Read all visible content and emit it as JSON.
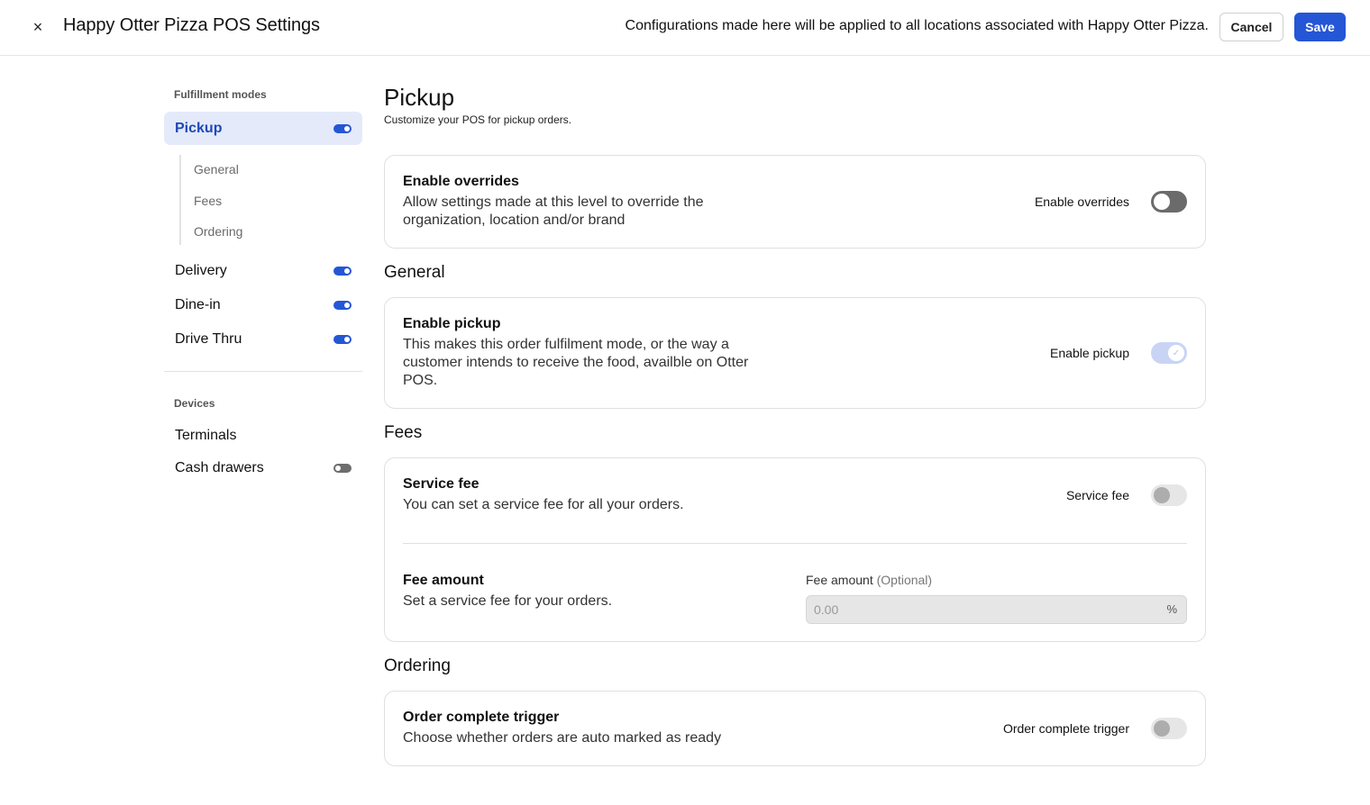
{
  "header": {
    "title": "Happy Otter Pizza POS Settings",
    "close_icon": "×",
    "notice": "Configurations made here will be applied to all locations associated with Happy Otter Pizza.",
    "cancel_label": "Cancel",
    "save_label": "Save"
  },
  "sidebar": {
    "fulfillment_heading": "Fulfillment modes",
    "pickup": {
      "label": "Pickup",
      "enabled": true
    },
    "pickup_subitems": [
      "General",
      "Fees",
      "Ordering"
    ],
    "delivery": {
      "label": "Delivery",
      "enabled": true
    },
    "dine_in": {
      "label": "Dine-in",
      "enabled": true
    },
    "drive_thru": {
      "label": "Drive Thru",
      "enabled": true
    },
    "devices_heading": "Devices",
    "terminals": {
      "label": "Terminals"
    },
    "cash_drawers": {
      "label": "Cash drawers",
      "enabled": false
    }
  },
  "main": {
    "title": "Pickup",
    "subtitle": "Customize your POS for pickup orders.",
    "overrides": {
      "title": "Enable overrides",
      "desc": "Allow settings made at this level to override the organization, location and/or brand",
      "toggle_label": "Enable overrides",
      "enabled": false
    },
    "general": {
      "heading": "General",
      "enable_pickup": {
        "title": "Enable pickup",
        "desc": "This makes this order fulfilment mode, or the way a customer intends to receive the food, availble on Otter POS.",
        "toggle_label": "Enable pickup",
        "enabled": true,
        "check_icon": "✓"
      }
    },
    "fees": {
      "heading": "Fees",
      "service_fee": {
        "title": "Service fee",
        "desc": "You can set a service fee for all your orders.",
        "toggle_label": "Service fee",
        "enabled": false
      },
      "fee_amount": {
        "title": "Fee amount",
        "desc": "Set a service fee for your orders.",
        "field_label": "Fee amount",
        "field_optional": "(Optional)",
        "placeholder": "0.00",
        "suffix": "%"
      }
    },
    "ordering": {
      "heading": "Ordering",
      "order_complete": {
        "title": "Order complete trigger",
        "desc": "Choose whether orders are auto marked as ready",
        "toggle_label": "Order complete trigger",
        "enabled": false
      }
    }
  },
  "colors": {
    "accent": "#2456d6",
    "active_bg": "#e4eafa",
    "active_text": "#1f48b8"
  }
}
